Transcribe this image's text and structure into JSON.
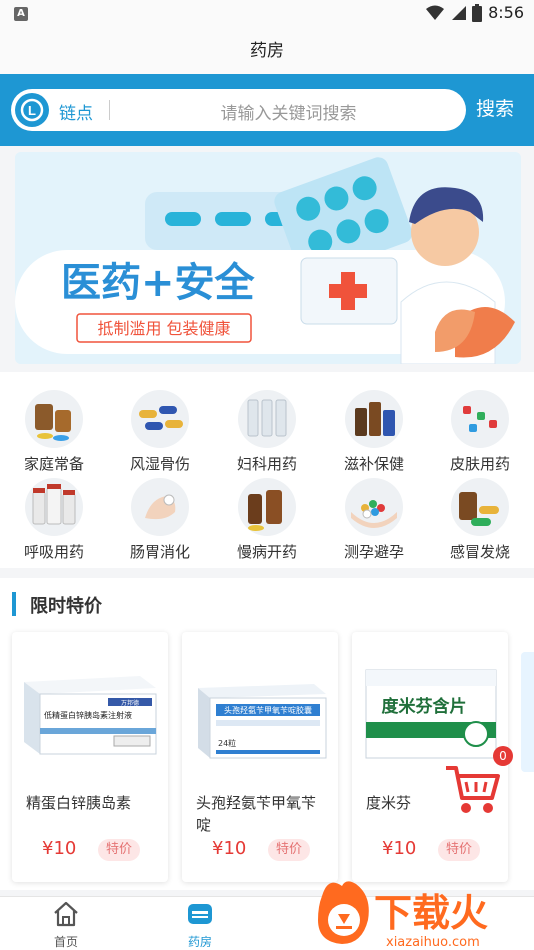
{
  "status_bar": {
    "time": "8:56",
    "left_badge": "A"
  },
  "header": {
    "title": "药房"
  },
  "search": {
    "brand": "链点",
    "placeholder": "请输入关键词搜索",
    "button": "搜索"
  },
  "banner": {
    "headline": "医药+安全",
    "subline": "抵制滥用 包装健康"
  },
  "categories": [
    {
      "label": "家庭常备",
      "icon": "pill-bottles-icon"
    },
    {
      "label": "风湿骨伤",
      "icon": "capsules-icon"
    },
    {
      "label": "妇科用药",
      "icon": "vials-icon"
    },
    {
      "label": "滋补保健",
      "icon": "tonic-bottles-icon"
    },
    {
      "label": "皮肤用药",
      "icon": "ointment-icon"
    },
    {
      "label": "呼吸用药",
      "icon": "medicine-bottles-icon"
    },
    {
      "label": "肠胃消化",
      "icon": "hand-pill-icon"
    },
    {
      "label": "慢病开药",
      "icon": "brown-bottles-icon"
    },
    {
      "label": "测孕避孕",
      "icon": "pills-in-hands-icon"
    },
    {
      "label": "感冒发烧",
      "icon": "cold-medicine-icon"
    }
  ],
  "deals": {
    "title": "限时特价",
    "tag": "特价",
    "products": [
      {
        "name": "精蛋白锌胰岛素",
        "price": "¥10",
        "box_text": "低精蛋白锌胰岛素注射液",
        "box_brand": "万邦德"
      },
      {
        "name": "头孢羟氨苄甲氧苄啶",
        "price": "¥10",
        "box_text": "头孢羟氨苄甲氧苄啶胶囊",
        "box_count": "24粒"
      },
      {
        "name": "度米芬",
        "price": "¥10",
        "box_text": "度米芬含片"
      }
    ]
  },
  "cart": {
    "count": "0"
  },
  "nav": [
    {
      "label": "首页",
      "icon": "home-icon",
      "active": false
    },
    {
      "label": "药房",
      "icon": "pharmacy-icon",
      "active": true
    }
  ],
  "watermark": {
    "text": "下载火",
    "url": "xiazaihuo.com"
  },
  "colors": {
    "accent": "#1e97d3",
    "price": "#e53935",
    "watermark": "#ff6a1f"
  }
}
